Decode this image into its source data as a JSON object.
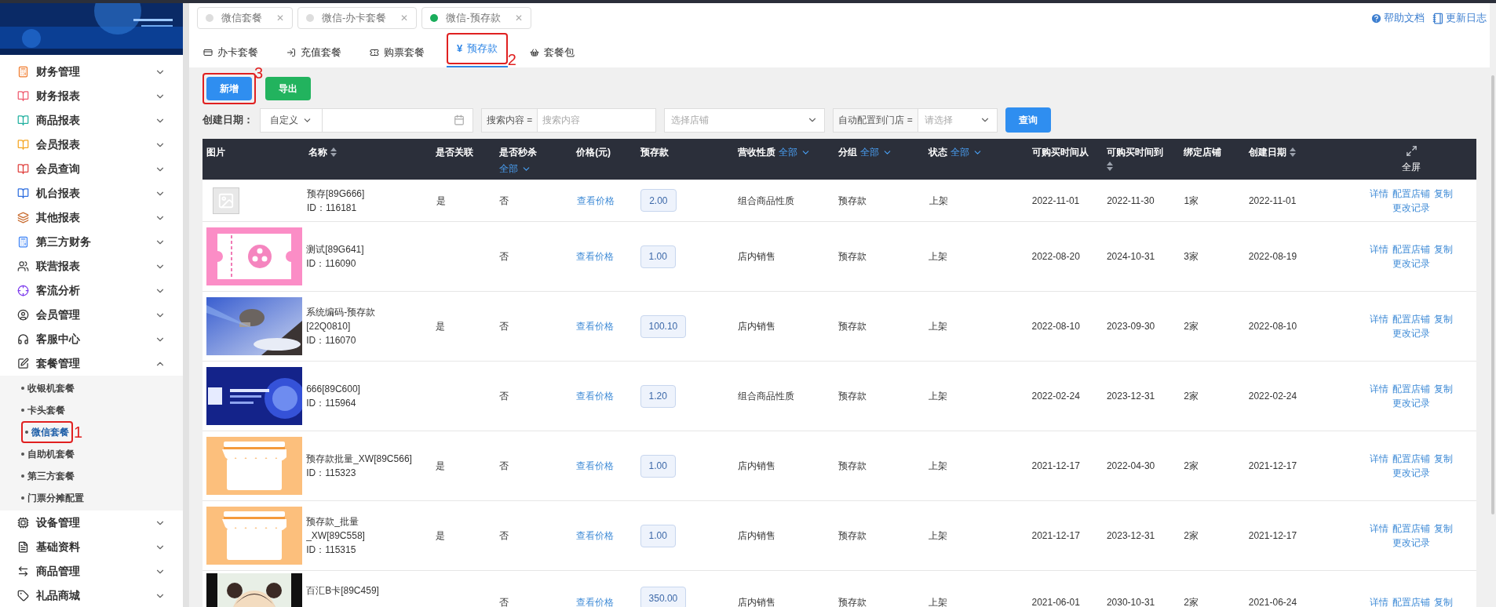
{
  "sidebar": {
    "items": [
      {
        "label": "财务管理",
        "expanded": false
      },
      {
        "label": "财务报表",
        "expanded": false
      },
      {
        "label": "商品报表",
        "expanded": false
      },
      {
        "label": "会员报表",
        "expanded": false
      },
      {
        "label": "会员查询",
        "expanded": false
      },
      {
        "label": "机台报表",
        "expanded": false
      },
      {
        "label": "其他报表",
        "expanded": false
      },
      {
        "label": "第三方财务",
        "expanded": false
      },
      {
        "label": "联营报表",
        "expanded": false
      },
      {
        "label": "客流分析",
        "expanded": false
      },
      {
        "label": "会员管理",
        "expanded": false
      },
      {
        "label": "客服中心",
        "expanded": false
      },
      {
        "label": "套餐管理",
        "expanded": true,
        "children": [
          {
            "label": "收银机套餐",
            "selected": false
          },
          {
            "label": "卡头套餐",
            "selected": false
          },
          {
            "label": "微信套餐",
            "selected": true,
            "callout": "1"
          },
          {
            "label": "自助机套餐",
            "selected": false
          },
          {
            "label": "第三方套餐",
            "selected": false
          },
          {
            "label": "门票分摊配置",
            "selected": false
          }
        ]
      },
      {
        "label": "设备管理",
        "expanded": false
      },
      {
        "label": "基础资料",
        "expanded": false
      },
      {
        "label": "商品管理",
        "expanded": false
      },
      {
        "label": "礼品商城",
        "expanded": false
      }
    ]
  },
  "page_tabs": [
    {
      "label": "微信套餐",
      "selected": false,
      "close": "✕"
    },
    {
      "label": "微信-办卡套餐",
      "selected": false,
      "close": "✕"
    },
    {
      "label": "微信-预存款",
      "selected": true,
      "close": "✕"
    }
  ],
  "header_links": [
    "帮助文档",
    "更新日志"
  ],
  "sub_tabs": [
    {
      "label": "办卡套餐",
      "selected": false
    },
    {
      "label": "充值套餐",
      "selected": false
    },
    {
      "label": "购票套餐",
      "selected": false
    },
    {
      "label": "预存款",
      "selected": true,
      "callout": "2",
      "symbol": "¥"
    },
    {
      "label": "套餐包",
      "selected": false
    }
  ],
  "buttons": [
    {
      "label": "新增",
      "kind": "primary",
      "callout": "3"
    },
    {
      "label": "导出",
      "kind": "success"
    }
  ],
  "filters": {
    "date_label": "创建日期：",
    "date_mode": "自定义",
    "search_label": "搜索内容 =",
    "search_placeholder": "搜索内容",
    "store_placeholder": "选择店铺",
    "auto_label": "自动配置到门店 =",
    "auto_placeholder": "请选择",
    "query_button": "查询"
  },
  "table": {
    "columns": [
      {
        "label": "图片"
      },
      {
        "label": "名称",
        "sort": true
      },
      {
        "label": "是否关联"
      },
      {
        "label": "是否秒杀",
        "filter": "全部",
        "filter_below": true
      },
      {
        "label": "价格(元)"
      },
      {
        "label": "预存款"
      },
      {
        "label": "营收性质",
        "filter": "全部"
      },
      {
        "label": "分组",
        "filter": "全部"
      },
      {
        "label": "状态",
        "filter": "全部"
      },
      {
        "label": "可购买时间从"
      },
      {
        "label": "可购买时间到",
        "sort": true,
        "sort_below": true
      },
      {
        "label": "绑定店铺"
      },
      {
        "label": "创建日期",
        "sort": true
      },
      {
        "label": "全屏",
        "kind": "fullscreen"
      }
    ],
    "rows": [
      {
        "kind": "placeholder",
        "name": "预存[89G666]",
        "id": "ID：116181",
        "linked": "是",
        "seckill": "否",
        "price": "查看价格",
        "deposit": "2.00",
        "revenue": "组合商品性质",
        "group": "预存款",
        "status": "上架",
        "from": "2022-11-01",
        "to": "2022-11-30",
        "stores": "1家",
        "created": "2022-11-01",
        "actions": [
          "详情",
          "配置店铺",
          "复制",
          "更改记录"
        ]
      },
      {
        "kind": "ticket",
        "name": "测试[89G641]",
        "id": "ID：116090",
        "linked": "",
        "seckill": "否",
        "price": "查看价格",
        "deposit": "1.00",
        "revenue": "店内销售",
        "group": "预存款",
        "status": "上架",
        "from": "2022-08-20",
        "to": "2024-10-31",
        "stores": "3家",
        "created": "2022-08-19",
        "actions": [
          "详情",
          "配置店铺",
          "复制",
          "更改记录"
        ]
      },
      {
        "name": "系统编码-预存款[22Q0810]",
        "id": "ID：116070",
        "linked": "是",
        "seckill": "否",
        "price": "查看价格",
        "deposit": "100.10",
        "revenue": "店内销售",
        "group": "预存款",
        "status": "上架",
        "from": "2022-08-10",
        "to": "2023-09-30",
        "stores": "2家",
        "created": "2022-08-10",
        "actions": [
          "详情",
          "配置店铺",
          "复制",
          "更改记录"
        ]
      },
      {
        "kind": "banner",
        "name": "666[89C600]",
        "id": "ID：115964",
        "linked": "",
        "seckill": "否",
        "price": "查看价格",
        "deposit": "1.20",
        "revenue": "组合商品性质",
        "group": "预存款",
        "status": "上架",
        "from": "2022-02-24",
        "to": "2023-12-31",
        "stores": "2家",
        "created": "2022-02-24",
        "actions": [
          "详情",
          "配置店铺",
          "复制",
          "更改记录"
        ]
      },
      {
        "kind": "shop",
        "name": "预存款批量_XW[89C566]",
        "id": "ID：115323",
        "linked": "是",
        "seckill": "否",
        "price": "查看价格",
        "deposit": "1.00",
        "revenue": "店内销售",
        "group": "预存款",
        "status": "上架",
        "from": "2021-12-17",
        "to": "2022-04-30",
        "stores": "2家",
        "created": "2021-12-17",
        "actions": [
          "详情",
          "配置店铺",
          "复制",
          "更改记录"
        ]
      },
      {
        "kind": "shop",
        "name": "预存款_批量_XW[89C558]",
        "id": "ID：115315",
        "linked": "是",
        "seckill": "否",
        "price": "查看价格",
        "deposit": "1.00",
        "revenue": "店内销售",
        "group": "预存款",
        "status": "上架",
        "from": "2021-12-17",
        "to": "2023-12-31",
        "stores": "2家",
        "created": "2021-12-17",
        "actions": [
          "详情",
          "配置店铺",
          "复制",
          "更改记录"
        ]
      },
      {
        "kind": "figure",
        "name": "百汇B卡[89C459]",
        "linked": "",
        "seckill": "否",
        "price": "查看价格",
        "deposit": "350.00",
        "revenue": "店内销售",
        "group": "预存款",
        "status": "上架",
        "from": "2021-06-01",
        "to": "2030-10-31",
        "stores": "2家",
        "created": "2021-06-24",
        "actions": [
          "详情",
          "配置店铺",
          "复制"
        ]
      }
    ]
  }
}
